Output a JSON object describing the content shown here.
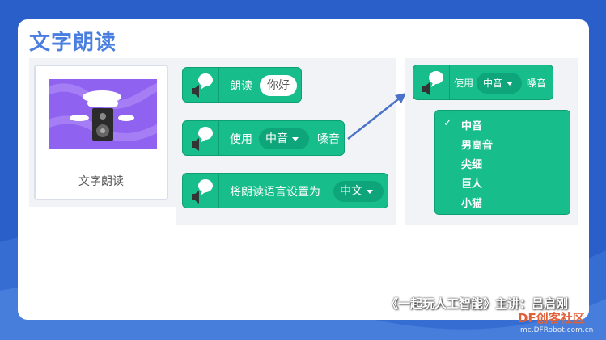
{
  "slide": {
    "title": "文字朗读",
    "footer": "《一起玩人工智能》主讲：吕启刚"
  },
  "extension": {
    "label": "文字朗读"
  },
  "blocks": {
    "speak": {
      "label": "朗读",
      "value": "你好"
    },
    "voice": {
      "prefix": "使用",
      "value": "中音",
      "suffix": "嗓音"
    },
    "language": {
      "label": "将朗读语言设置为",
      "value": "中文"
    }
  },
  "popup": {
    "block": {
      "prefix": "使用",
      "value": "中音",
      "suffix": "嗓音"
    },
    "check": "✓",
    "options": [
      "中音",
      "男高音",
      "尖细",
      "巨人",
      "小猫"
    ]
  },
  "watermark": {
    "brand": "DF创客社区",
    "url": "mc.DFRobot.com.cn"
  },
  "colors": {
    "block": "#17bd8b",
    "title": "#4a7fe0",
    "background": "#2a5fc9"
  }
}
